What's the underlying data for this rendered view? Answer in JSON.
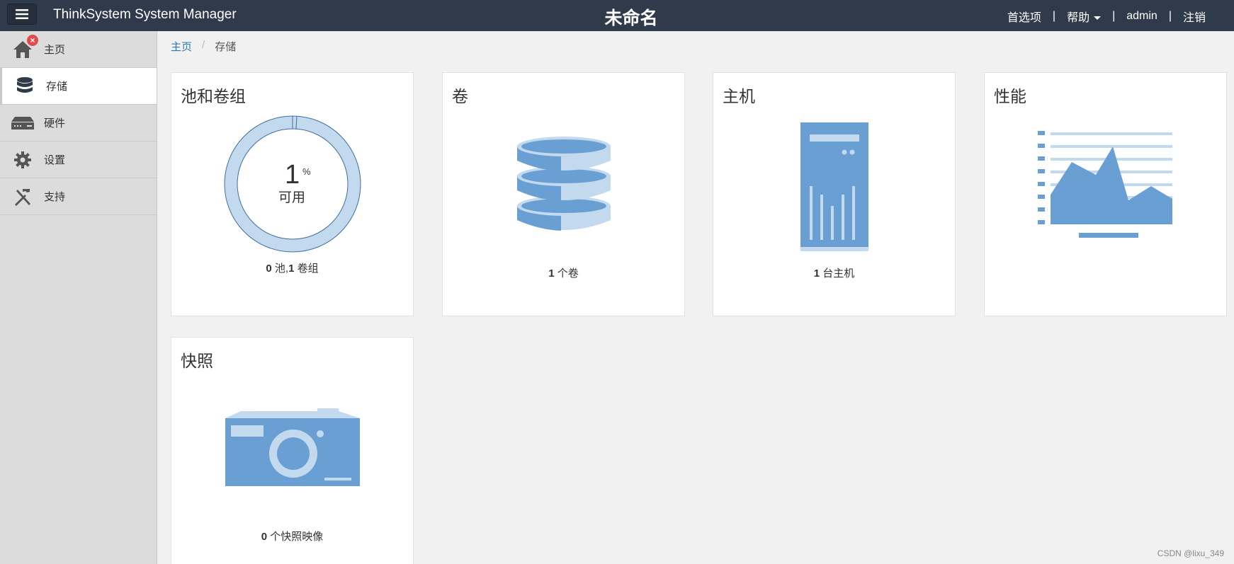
{
  "header": {
    "app_title": "ThinkSystem System Manager",
    "system_name": "未命名",
    "links": {
      "preferences": "首选项",
      "help": "帮助",
      "user": "admin",
      "logout": "注销"
    },
    "separator": "|"
  },
  "sidebar": {
    "items": [
      {
        "label": "主页",
        "icon": "home-icon",
        "badge": "×"
      },
      {
        "label": "存储",
        "icon": "database-icon",
        "active": true
      },
      {
        "label": "硬件",
        "icon": "hardware-icon"
      },
      {
        "label": "设置",
        "icon": "gear-icon"
      },
      {
        "label": "支持",
        "icon": "tools-icon"
      }
    ]
  },
  "breadcrumb": {
    "home": "主页",
    "separator": "/",
    "current": "存储"
  },
  "cards": {
    "pools": {
      "title": "池和卷组",
      "percent": "1",
      "percent_sign": "%",
      "percent_label": "可用",
      "used_fraction": 0.01,
      "count_pools": "0",
      "pools_text": "池,",
      "count_groups": "1",
      "groups_text": "卷组"
    },
    "volumes": {
      "title": "卷",
      "count": "1",
      "text": "个卷",
      "icon": "database-stack-icon"
    },
    "hosts": {
      "title": "主机",
      "count": "1",
      "text": "台主机",
      "icon": "server-tower-icon"
    },
    "performance": {
      "title": "性能",
      "icon": "performance-chart-icon"
    },
    "snapshots": {
      "title": "快照",
      "count": "0",
      "text": "个快照映像",
      "icon": "camera-icon"
    }
  },
  "colors": {
    "topbar": "#2f3b4b",
    "accent_blue": "#6a9fd4",
    "light_blue": "#c3daee",
    "link": "#2a7ab8"
  },
  "watermark": "CSDN @lixu_349"
}
